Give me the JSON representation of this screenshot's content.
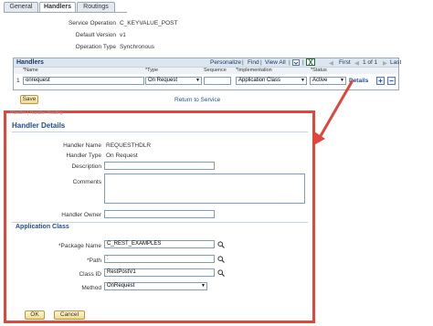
{
  "tabs": [
    {
      "label": "General"
    },
    {
      "label": "Handlers"
    },
    {
      "label": "Routings"
    }
  ],
  "service": {
    "operation_label": "Service Operation",
    "operation_value": "C_KEYVALUE_POST",
    "version_label": "Default Version",
    "version_value": "v1",
    "type_label": "Operation Type",
    "type_value": "Synchronous"
  },
  "grid": {
    "title": "Handlers",
    "personalize": "Personalize",
    "find": "Find",
    "view_all": "View All",
    "first": "First",
    "pager": "1 of 1",
    "last": "Last",
    "columns": {
      "name": "*Name",
      "type": "*Type",
      "sequence": "Sequence",
      "implementation": "*Implementation",
      "status": "*Status"
    },
    "row": {
      "num": "1",
      "name": "onrequest",
      "type": "On Request",
      "implementation": "Application Class",
      "status": "Active",
      "details": "Details"
    },
    "add_symbol": "+",
    "remove_symbol": "−"
  },
  "save_label": "Save",
  "return_link": "Return to Service",
  "ghost_text": "Handler | Handler Routing",
  "modal": {
    "title": "Handler Details",
    "name_label": "Handler Name",
    "name_value": "REQUESTHDLR",
    "type_label": "Handler Type",
    "type_value": "On Request",
    "description_label": "Description",
    "comments_label": "Comments",
    "owner_label": "Handler Owner",
    "section_title": "Application Class",
    "package_label": "*Package Name",
    "package_value": "C_REST_EXAMPLES",
    "path_label": "*Path",
    "path_value": ":",
    "classid_label": "Class ID",
    "classid_value": "RestPostV1",
    "method_label": "Method",
    "method_value": "OnRequest",
    "ok_label": "OK",
    "cancel_label": "Cancel"
  },
  "colors": {
    "highlight": "#e0463c",
    "link": "#1f4e8c",
    "grid_header": "#dce6f0"
  }
}
